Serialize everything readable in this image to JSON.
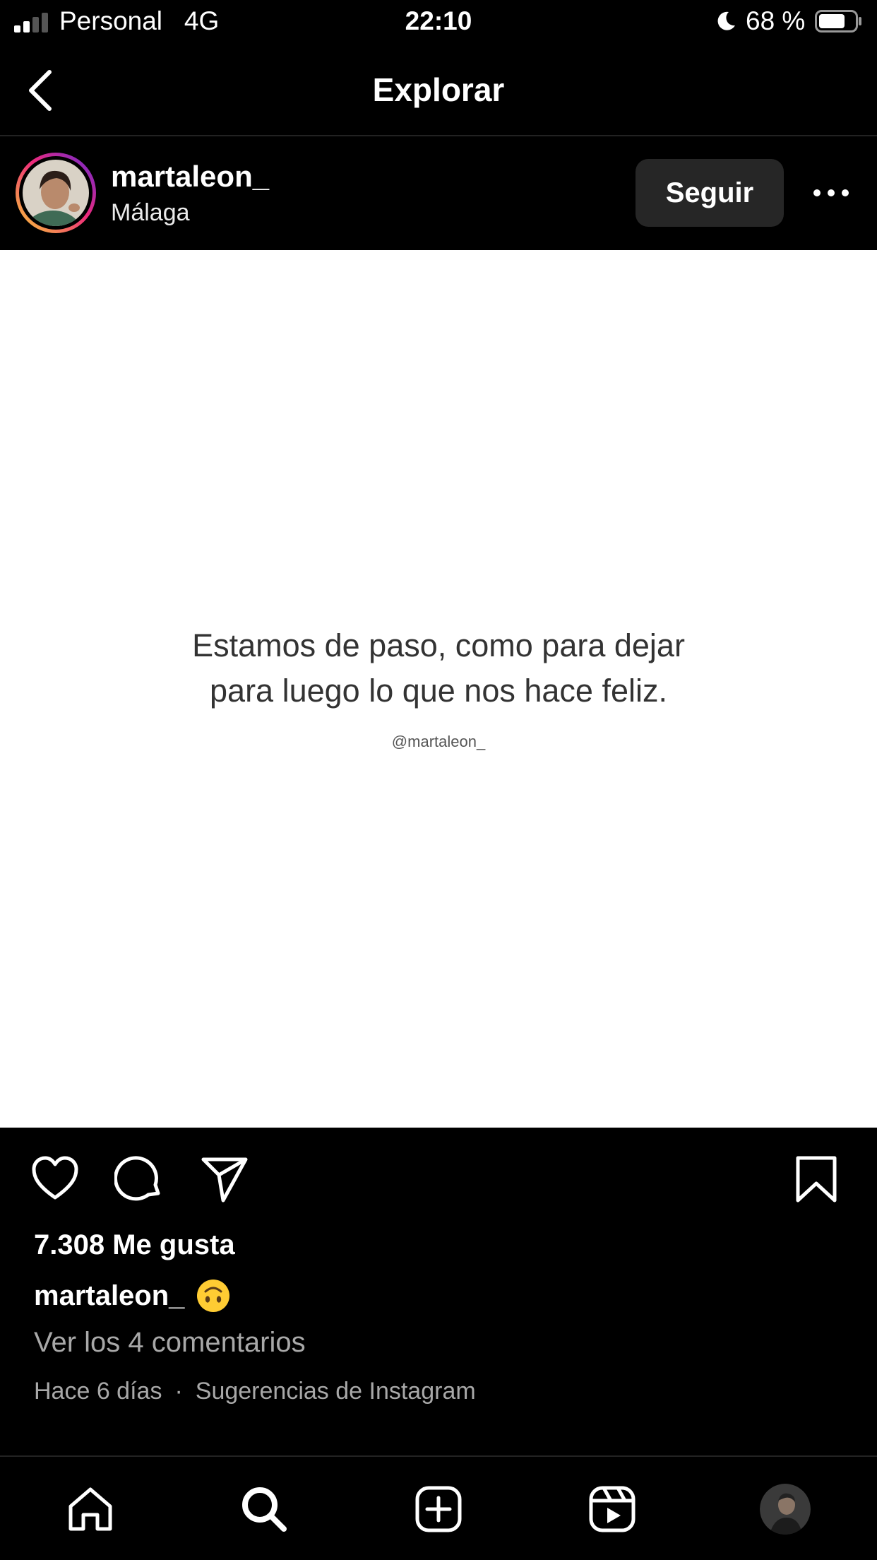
{
  "status_bar": {
    "carrier": "Personal",
    "network": "4G",
    "time": "22:10",
    "battery_percent": "68 %"
  },
  "header": {
    "title": "Explorar"
  },
  "post": {
    "username": "martaleon_",
    "location": "Málaga",
    "follow_label": "Seguir",
    "image_quote": "Estamos de paso, como para dejar\npara luego lo que nos hace feliz.",
    "image_handle": "@martaleon_",
    "likes": "7.308 Me gusta",
    "caption_user": "martaleon_",
    "view_comments": "Ver los 4 comentarios",
    "time_ago": "Hace 6 días",
    "separator": "·",
    "source": "Sugerencias de Instagram"
  },
  "icons": {
    "back": "chevron-left-icon",
    "more": "more-horizontal-icon",
    "like": "heart-icon",
    "comment": "comment-icon",
    "share": "send-icon",
    "save": "bookmark-icon",
    "emoji": "upside-down-face-emoji",
    "tabs": [
      "home-icon",
      "search-icon",
      "create-icon",
      "reels-icon",
      "profile-avatar"
    ]
  },
  "colors": {
    "background": "#000000",
    "follow_button": "#262626",
    "secondary_text": "#a8a8a8",
    "story_ring": [
      "#f9ce34",
      "#ee2a7b",
      "#6228d7"
    ]
  }
}
